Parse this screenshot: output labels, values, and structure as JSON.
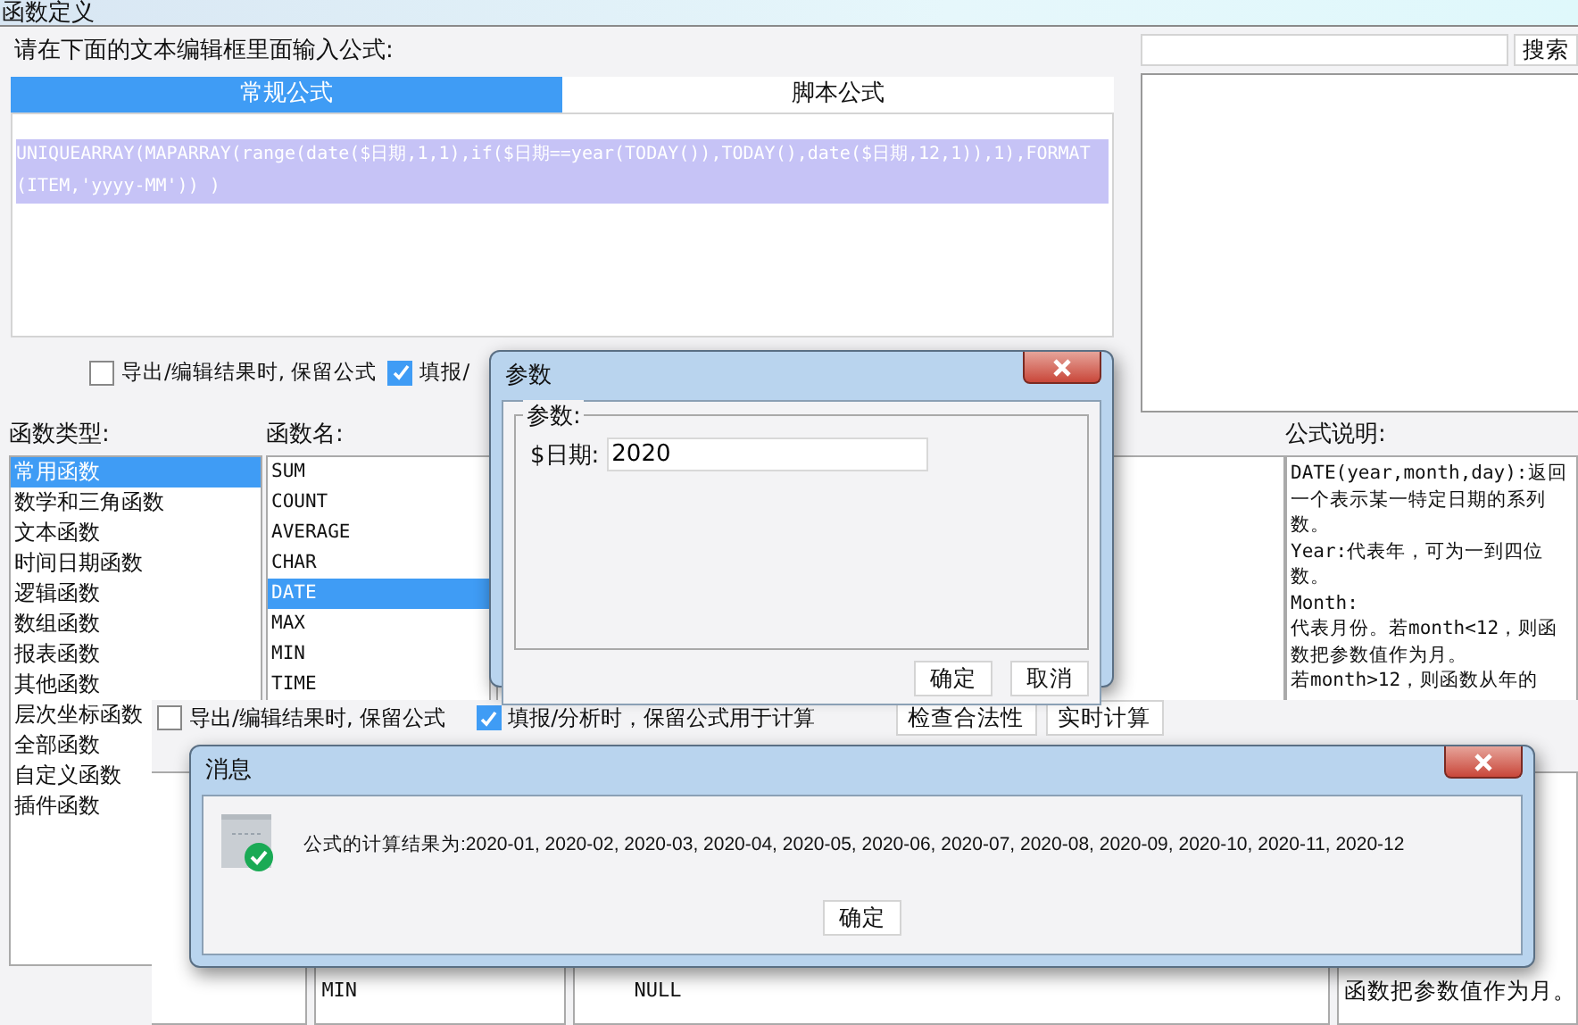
{
  "main_window": {
    "title": "函数定义",
    "prompt": "请在下面的文本编辑框里面输入公式:",
    "tabs": [
      {
        "label": "常规公式",
        "selected": true
      },
      {
        "label": "脚本公式",
        "selected": false
      }
    ],
    "formula": {
      "text": "UNIQUEARRAY(MAPARRAY(range(date($日期,1,1),if($日期==year(TODAY()),TODAY(),date($日期,12,1)),1),FORMAT(ITEM,'yyyy-MM')) )",
      "selected": true
    },
    "search": {
      "button": "搜索"
    },
    "options": [
      {
        "label": "导出/编辑结果时, 保留公式",
        "checked": false
      },
      {
        "label": "填报/",
        "checked": true
      }
    ],
    "category_label": "函数类型:",
    "categories": [
      {
        "label": "常用函数",
        "selected": true
      },
      {
        "label": "数学和三角函数",
        "selected": false
      },
      {
        "label": "文本函数",
        "selected": false
      },
      {
        "label": "时间日期函数",
        "selected": false
      },
      {
        "label": "逻辑函数",
        "selected": false
      },
      {
        "label": "数组函数",
        "selected": false
      },
      {
        "label": "报表函数",
        "selected": false
      },
      {
        "label": "其他函数",
        "selected": false
      },
      {
        "label": "层次坐标函数",
        "selected": false
      },
      {
        "label": "全部函数",
        "selected": false
      },
      {
        "label": "自定义函数",
        "selected": false
      },
      {
        "label": "插件函数",
        "selected": false
      }
    ],
    "function_label": "函数名:",
    "functions": [
      {
        "label": "SUM",
        "selected": false
      },
      {
        "label": "COUNT",
        "selected": false
      },
      {
        "label": "AVERAGE",
        "selected": false
      },
      {
        "label": "CHAR",
        "selected": false
      },
      {
        "label": "DATE",
        "selected": true
      },
      {
        "label": "MAX",
        "selected": false
      },
      {
        "label": "MIN",
        "selected": false
      },
      {
        "label": "TIME",
        "selected": false
      }
    ],
    "description_label": "公式说明:",
    "description": [
      "DATE(year,month,day):返回一个表示某一特定日期的系列数。",
      "Year:代表年，可为一到四位数。",
      "Month:",
      "代表月份。若month<12，则函数把参数值作为月。",
      "若month>12，则函数从年的"
    ]
  },
  "behind_window": {
    "options": [
      {
        "label": "导出/编辑结果时, 保留公式",
        "checked": false
      },
      {
        "label": "填报/分析时，保留公式用于计算",
        "checked": true
      }
    ],
    "buttons": [
      "检查合法性",
      "实时计算"
    ],
    "functions": [
      "MIN"
    ],
    "tree_items": [
      "NULL"
    ],
    "description": [
      "函数把参数值作为月。"
    ]
  },
  "param_dialog": {
    "title": "参数",
    "group": "参数:",
    "fields": [
      {
        "label": "$日期:",
        "value": "2020"
      }
    ],
    "buttons": [
      "确定",
      "取消"
    ]
  },
  "message_dialog": {
    "title": "消息",
    "message": "公式的计算结果为:2020-01, 2020-02, 2020-03, 2020-04, 2020-05, 2020-06, 2020-07, 2020-08, 2020-09, 2020-10, 2020-11, 2020-12",
    "buttons": [
      "确定"
    ]
  }
}
